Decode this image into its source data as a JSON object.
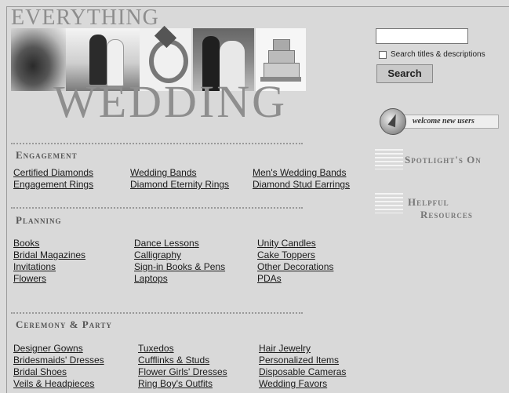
{
  "header": {
    "title_top": "EVERYTHING",
    "title_big": "WEDDING"
  },
  "search": {
    "input_value": "",
    "checkbox_label": "Search titles & descriptions",
    "button_label": "Search"
  },
  "sidebar": {
    "welcome_label": "welcome new users",
    "spotlight_label": "Spotlight's On",
    "helpful_line1": "Helpful",
    "helpful_line2": "Resources"
  },
  "sections": [
    {
      "heading": "Engagement",
      "columns": [
        [
          "Certified Diamonds",
          "Engagement Rings"
        ],
        [
          "Wedding Bands",
          "Diamond Eternity Rings"
        ],
        [
          "Men's Wedding Bands",
          "Diamond Stud Earrings"
        ]
      ]
    },
    {
      "heading": "Planning",
      "columns": [
        [
          "Books",
          "Bridal Magazines",
          "Invitations",
          "Flowers"
        ],
        [
          "Dance Lessons",
          "Calligraphy",
          "Sign-in Books & Pens",
          "Laptops"
        ],
        [
          "Unity Candles",
          "Cake Toppers",
          "Other Decorations",
          "PDAs"
        ]
      ]
    },
    {
      "heading": "Ceremony & Party",
      "columns": [
        [
          "Designer Gowns",
          "Bridesmaids' Dresses",
          "Bridal Shoes",
          "Veils & Headpieces"
        ],
        [
          "Tuxedos",
          "Cufflinks & Studs",
          "Flower Girls' Dresses",
          "Ring Boy's Outfits"
        ],
        [
          "Hair Jewelry",
          "Personalized Items",
          "Disposable Cameras",
          "Wedding Favors"
        ]
      ]
    }
  ]
}
